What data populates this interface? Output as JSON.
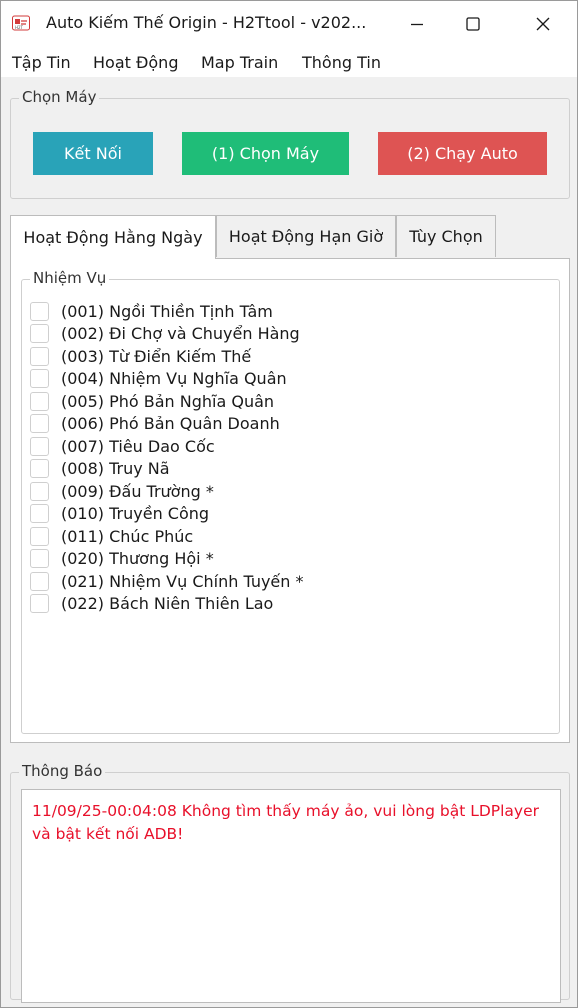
{
  "window": {
    "title": "Auto Kiếm Thế Origin - H2Ttool - v202...",
    "icon": "h2t-app-icon"
  },
  "menu": [
    "Tập Tin",
    "Hoạt Động",
    "Map Train",
    "Thông Tin"
  ],
  "machine_group": {
    "title": "Chọn Máy",
    "buttons": {
      "connect": "Kết Nối",
      "select": "(1) Chọn Máy",
      "run": "(2) Chạy Auto"
    }
  },
  "colors": {
    "connect": "#29a3b8",
    "select": "#1fbd78",
    "run": "#de5453",
    "log_text": "#e8102a"
  },
  "tabs": [
    "Hoạt Động Hằng Ngày",
    "Hoạt Động Hạn Giờ",
    "Tùy Chọn"
  ],
  "active_tab": "Hoạt Động Hằng Ngày",
  "tasks": {
    "title": "Nhiệm Vụ",
    "items": [
      {
        "label": "(001) Ngồi Thiền Tịnh Tâm",
        "checked": false
      },
      {
        "label": "(002) Đi Chợ và Chuyển Hàng",
        "checked": false
      },
      {
        "label": "(003) Từ Điển Kiếm Thế",
        "checked": false
      },
      {
        "label": "(004) Nhiệm Vụ Nghĩa Quân",
        "checked": false
      },
      {
        "label": "(005) Phó Bản Nghĩa Quân",
        "checked": false
      },
      {
        "label": "(006) Phó Bản Quân Doanh",
        "checked": false
      },
      {
        "label": "(007) Tiêu Dao Cốc",
        "checked": false
      },
      {
        "label": "(008) Truy Nã",
        "checked": false
      },
      {
        "label": "(009) Đấu Trường *",
        "checked": false
      },
      {
        "label": "(010) Truyền Công",
        "checked": false
      },
      {
        "label": "(011) Chúc Phúc",
        "checked": false
      },
      {
        "label": "(020) Thương Hội *",
        "checked": false
      },
      {
        "label": "(021) Nhiệm Vụ Chính Tuyến *",
        "checked": false
      },
      {
        "label": "(022) Bách Niên Thiên Lao",
        "checked": false
      }
    ]
  },
  "log": {
    "title": "Thông Báo",
    "message": "11/09/25-00:04:08 Không tìm thấy máy ảo, vui lòng bật LDPlayer và bật kết nối ADB!"
  }
}
